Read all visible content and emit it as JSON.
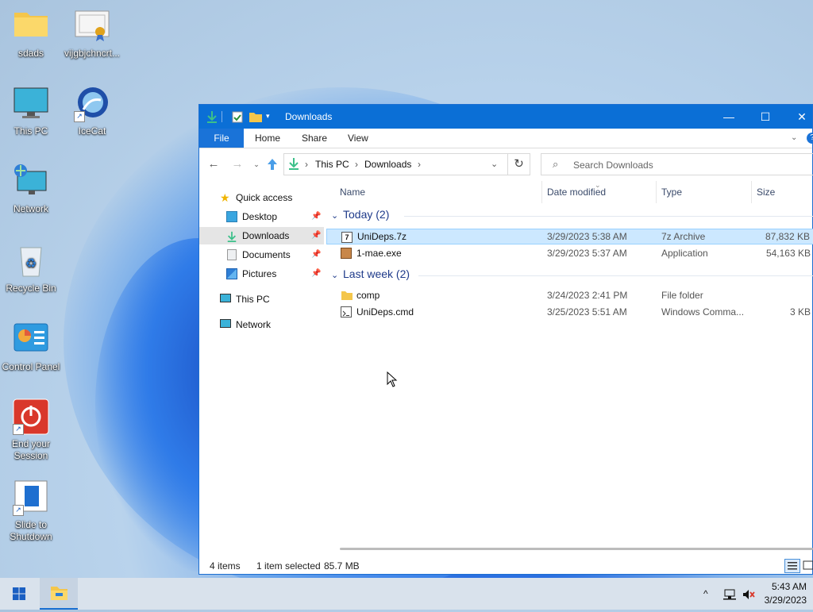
{
  "desktop": {
    "icons": [
      {
        "label": "sdads"
      },
      {
        "label": "vijgbjchncrt..."
      },
      {
        "label": "This PC"
      },
      {
        "label": "IceCat"
      },
      {
        "label": "Network"
      },
      {
        "label": "Recycle Bin"
      },
      {
        "label": "Control Panel"
      },
      {
        "label": "End your Session"
      },
      {
        "label": "Slide to Shutdown"
      }
    ]
  },
  "window": {
    "title": "Downloads",
    "ribbon_tabs": [
      "File",
      "Home",
      "Share",
      "View"
    ],
    "breadcrumb": [
      "This PC",
      "Downloads"
    ],
    "search_placeholder": "Search Downloads",
    "nav": {
      "quick_access": "Quick access",
      "items": [
        "Desktop",
        "Downloads",
        "Documents",
        "Pictures"
      ],
      "selected": "Downloads",
      "this_pc": "This PC",
      "network": "Network"
    },
    "columns": [
      "Name",
      "Date modified",
      "Type",
      "Size"
    ],
    "groups": [
      {
        "title": "Today (2)",
        "files": [
          {
            "name": "UniDeps.7z",
            "date": "3/29/2023 5:38 AM",
            "type": "7z Archive",
            "size": "87,832 KB",
            "selected": true
          },
          {
            "name": "1-mae.exe",
            "date": "3/29/2023 5:37 AM",
            "type": "Application",
            "size": "54,163 KB",
            "selected": false
          }
        ]
      },
      {
        "title": "Last week (2)",
        "files": [
          {
            "name": "comp",
            "date": "3/24/2023 2:41 PM",
            "type": "File folder",
            "size": "",
            "selected": false
          },
          {
            "name": "UniDeps.cmd",
            "date": "3/25/2023 5:51 AM",
            "type": "Windows Comma...",
            "size": "3 KB",
            "selected": false
          }
        ]
      }
    ],
    "status": {
      "items": "4 items",
      "selection": "1 item selected",
      "size": "85.7 MB"
    }
  },
  "taskbar": {
    "time": "5:43 AM",
    "date": "3/29/2023"
  },
  "colors": {
    "accent": "#0b6fd6",
    "selection": "#cce8ff",
    "group_title": "#1e3a8a"
  }
}
